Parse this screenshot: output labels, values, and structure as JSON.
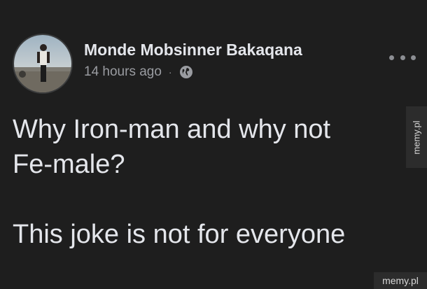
{
  "post": {
    "author": "Monde Mobsinner Bakaqana",
    "time": "14 hours ago",
    "separator": "·",
    "privacy_icon": "globe-icon",
    "more_icon": "more-options-icon",
    "text_lines": [
      "Why Iron-man and why not",
      "Fe-male?",
      "This joke is not for everyone"
    ]
  },
  "watermarks": {
    "side": "memy.pl",
    "corner": "memy.pl"
  },
  "colors": {
    "background": "#1e1e1e",
    "text": "#e4e6eb",
    "muted": "#9a9ca1"
  }
}
